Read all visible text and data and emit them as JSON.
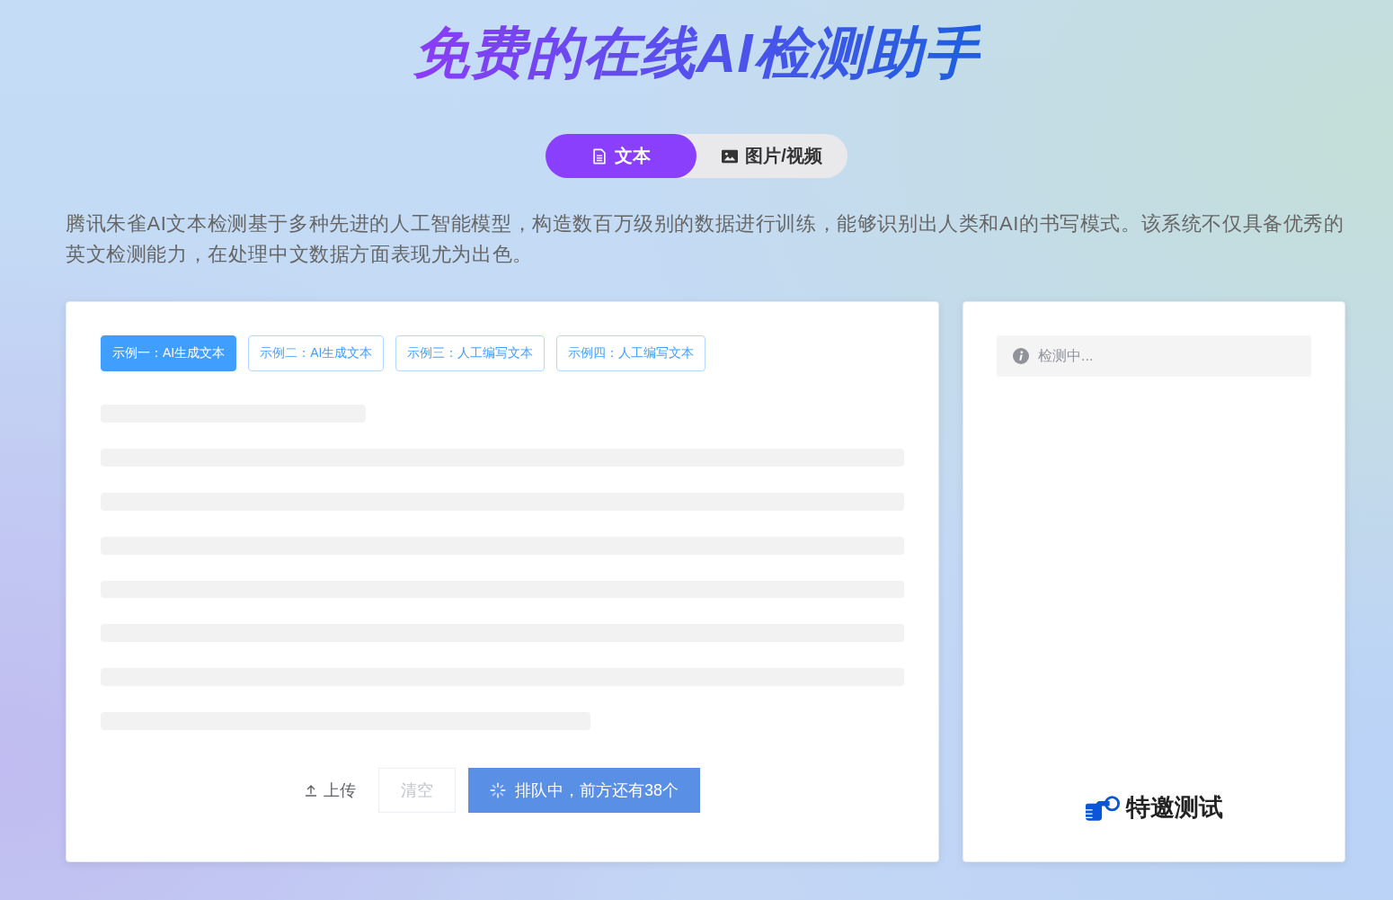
{
  "title": "免费的在线AI检测助手",
  "mode_tabs": [
    {
      "kind": "text",
      "label": "文本",
      "selected": true
    },
    {
      "kind": "image",
      "label": "图片/视频",
      "selected": false
    }
  ],
  "description": "腾讯朱雀AI文本检测基于多种先进的人工智能模型，构造数百万级别的数据进行训练，能够识别出人类和AI的书写模式。该系统不仅具备优秀的英文检测能力，在处理中文数据方面表现尤为出色。",
  "editor": {
    "examples": [
      {
        "label": "示例一：AI生成文本",
        "selected": true
      },
      {
        "label": "示例二：AI生成文本",
        "selected": false
      },
      {
        "label": "示例三：人工编写文本",
        "selected": false
      },
      {
        "label": "示例四：人工编写文本",
        "selected": false
      }
    ],
    "loading": true,
    "actions": [
      {
        "kind": "upload",
        "label": "上传"
      },
      {
        "kind": "clear",
        "label": "清空",
        "disabled": true
      },
      {
        "kind": "submit",
        "label": "排队中，前方还有38个",
        "loading": true
      }
    ]
  },
  "result": {
    "status": {
      "kind": "info",
      "text": "检测中..."
    },
    "promo": {
      "label": "特邀测试"
    }
  }
}
